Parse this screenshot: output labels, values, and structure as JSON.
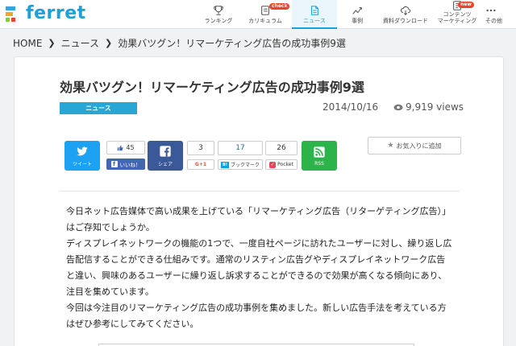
{
  "header": {
    "logo_text": "ferret",
    "nav": [
      {
        "label": "ランキング",
        "icon": "trophy-icon"
      },
      {
        "label": "カリキュラム",
        "icon": "notebook-icon",
        "badge": "check"
      },
      {
        "label": "ニュース",
        "icon": "news-icon",
        "active": true
      },
      {
        "label": "事例",
        "icon": "trend-icon"
      },
      {
        "label": "資料ダウンロード",
        "icon": "cloud-download-icon"
      },
      {
        "label_line1": "コンテンツ",
        "label_line2": "マーケティング",
        "icon": "document-icon",
        "badge": "new"
      },
      {
        "label": "その他",
        "icon": "more-icon"
      }
    ]
  },
  "breadcrumb": {
    "home": "HOME",
    "news": "ニュース",
    "current": "効果バツグン！リマーケティング広告の成功事例9選"
  },
  "article": {
    "title": "効果バツグン！リマーケティング広告の成功事例9選",
    "category": "ニュース",
    "date": "2014/10/16",
    "views": "9,919 views"
  },
  "share": {
    "twitter_label": "ツイート",
    "like_count": "45",
    "like_label": "いいね！",
    "facebook_label": "シェア",
    "gplus_count": "3",
    "gplus_label": "G+1",
    "hatena_count": "17",
    "hatena_label": "ブックマーク",
    "hatena_mark": "B!",
    "pocket_count": "26",
    "pocket_label": "Pocket",
    "rss_label": "RSS",
    "favorite_label": "お気入りに追加"
  },
  "body": {
    "paragraphs": [
      "今日ネット広告媒体で高い成果を上げている「リマーケティング広告（リターゲティング広告）」はご存知でしょうか。",
      "ディスプレイネットワークの機能の1つで、一度自社ページに訪れたユーザーに対し、繰り返し広告配信することができる仕組みです。通常のリスティン広告グやディスプレイネットワーク広告と違い、興味のあるユーザーに繰り返し訴求することができるので効果が高くなる傾向にあり、注目を集めています。",
      "今回は今注目のリマーケティング広告の成功事例を集めました。新しい広告手法を考えている方はぜひ参考にしてみてください。"
    ]
  },
  "colors": {
    "brand": "#1aa1d8",
    "twitter": "#1da1f2",
    "facebook": "#3b5998",
    "rss": "#2cb34a",
    "category": "#28a6d6"
  }
}
